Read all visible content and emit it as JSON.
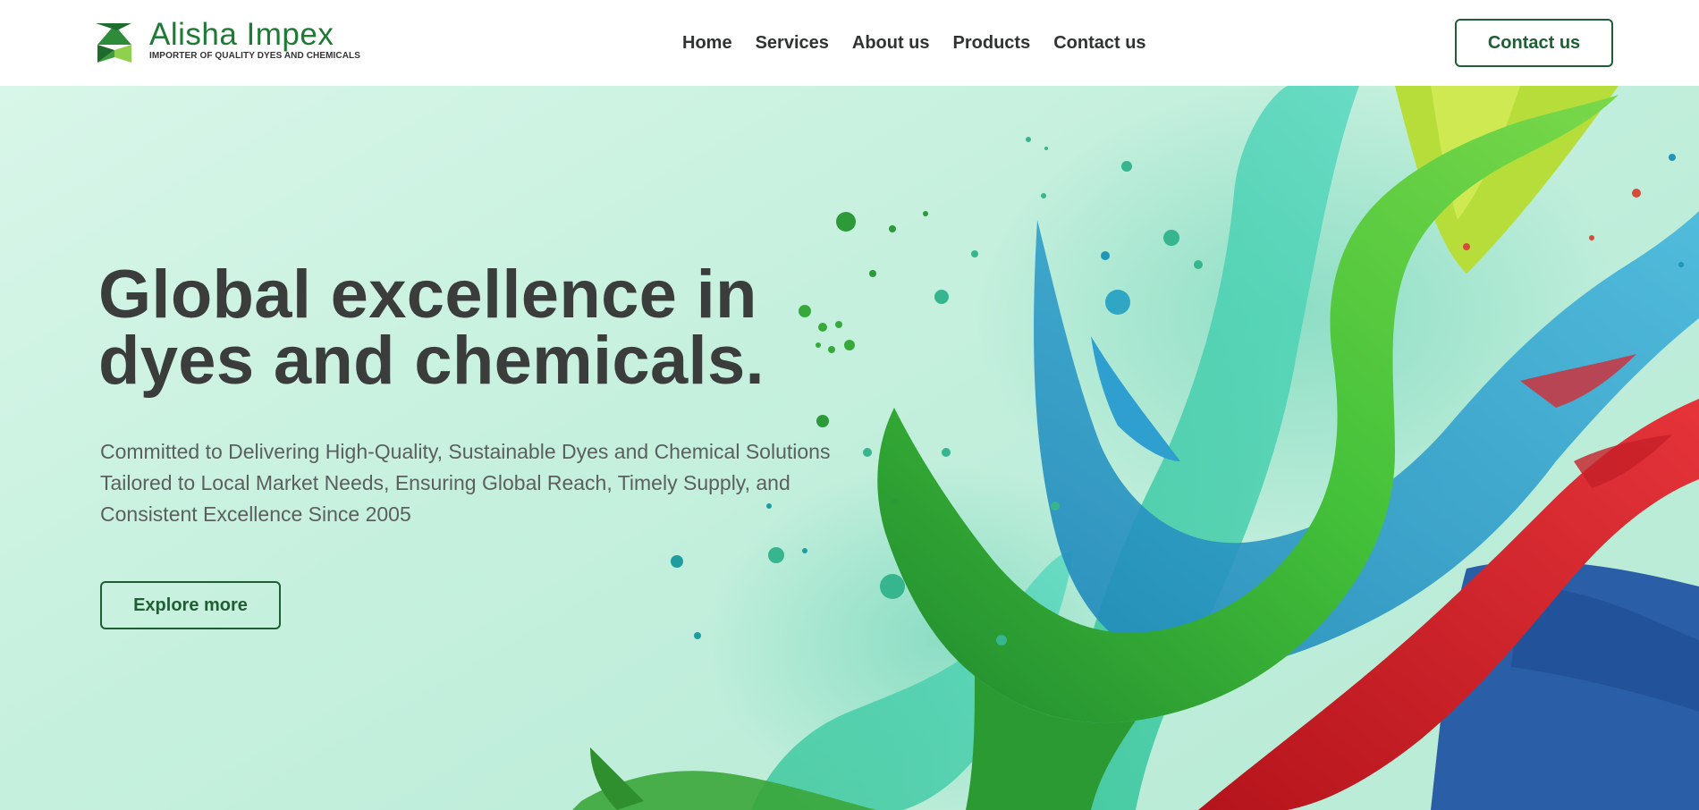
{
  "brand": {
    "name": "Alisha Impex",
    "tagline": "IMPORTER OF QUALITY DYES AND CHEMICALS",
    "primary_color": "#1e7a35",
    "logo_icon": "logo-leaf-arrow-icon"
  },
  "nav": {
    "items": [
      {
        "label": "Home"
      },
      {
        "label": "Services"
      },
      {
        "label": "About us"
      },
      {
        "label": "Products"
      },
      {
        "label": "Contact us"
      }
    ],
    "cta_label": "Contact us"
  },
  "hero": {
    "title_line1": "Global excellence in",
    "title_line2": "dyes and chemicals.",
    "subtitle": "Committed to Delivering High-Quality, Sustainable Dyes and Chemical Solutions Tailored to Local Market Needs, Ensuring Global Reach, Timely Supply, and Consistent Excellence Since 2005",
    "cta_label": "Explore more",
    "background_image": "paint-splash-illustration"
  },
  "colors": {
    "button_border": "#1f5e32",
    "heading": "#3a3d3c",
    "body_text": "#5b5f5e",
    "hero_background": "#c8f1df"
  }
}
